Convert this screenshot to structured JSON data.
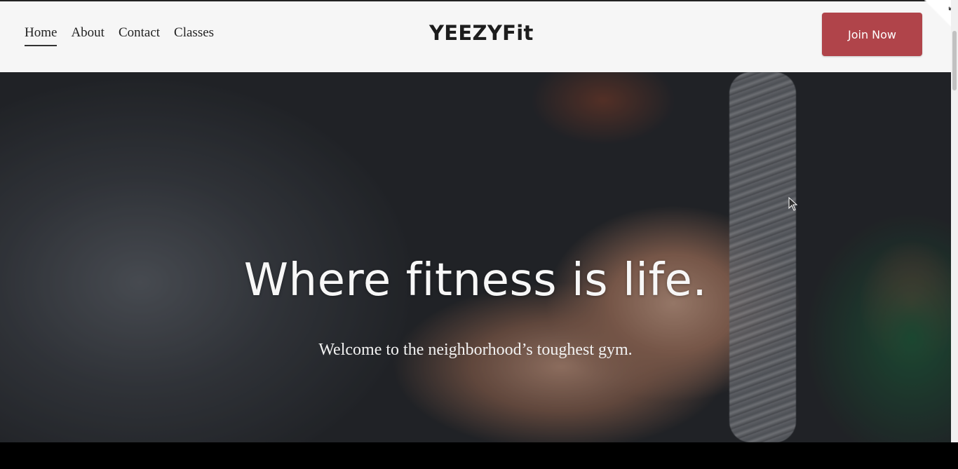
{
  "nav": {
    "items": [
      {
        "label": "Home",
        "active": true
      },
      {
        "label": "About",
        "active": false
      },
      {
        "label": "Contact",
        "active": false
      },
      {
        "label": "Classes",
        "active": false
      }
    ]
  },
  "brand": {
    "name": "YEEZYFit"
  },
  "header": {
    "cta_label": "Join Now",
    "cta_color": "#b0444a"
  },
  "hero": {
    "title": "Where fitness is life.",
    "subtitle": "Welcome to the neighborhood’s toughest gym."
  },
  "icons": {
    "corner": "collapse-arrow-icon",
    "cursor": "mouse-pointer-icon"
  }
}
